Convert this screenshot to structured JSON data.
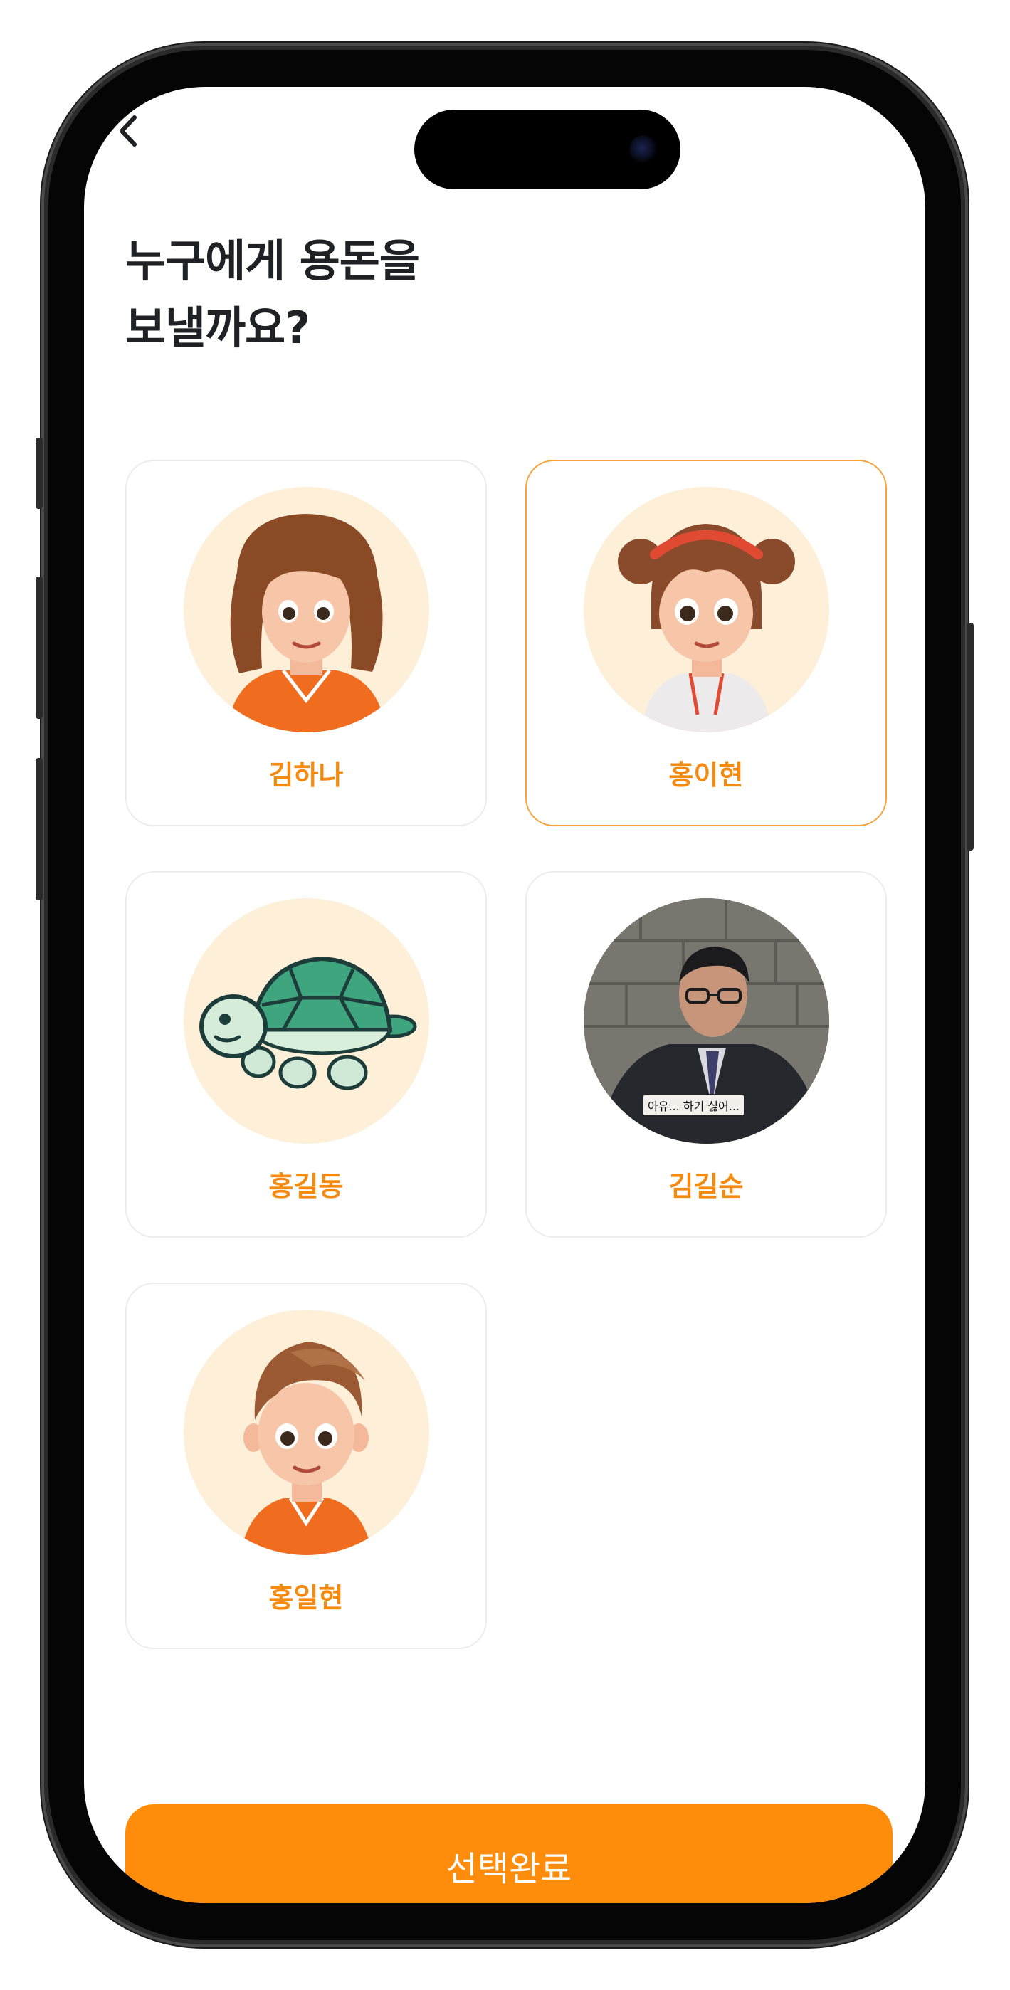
{
  "header": {
    "title_line1": "누구에게 용돈을",
    "title_line2": "보낼까요?"
  },
  "recipients": [
    {
      "name": "김하나",
      "avatar": "girl-cartoon-avatar",
      "selected": false
    },
    {
      "name": "홍이현",
      "avatar": "girl-headband-cartoon-avatar",
      "selected": true
    },
    {
      "name": "홍길동",
      "avatar": "turtle-cartoon-avatar",
      "selected": false
    },
    {
      "name": "김길순",
      "avatar": "man-photo-avatar",
      "photo_caption": "아유... 하기 싫어...",
      "selected": false
    },
    {
      "name": "홍일현",
      "avatar": "boy-cartoon-avatar",
      "selected": false
    }
  ],
  "footer": {
    "confirm_label": "선택완료"
  },
  "colors": {
    "accent": "#ff8c0a",
    "accent_text": "#f58a10",
    "selected_border": "#f7a23a",
    "avatar_bg": "#fdefd8",
    "title": "#1f2124"
  }
}
